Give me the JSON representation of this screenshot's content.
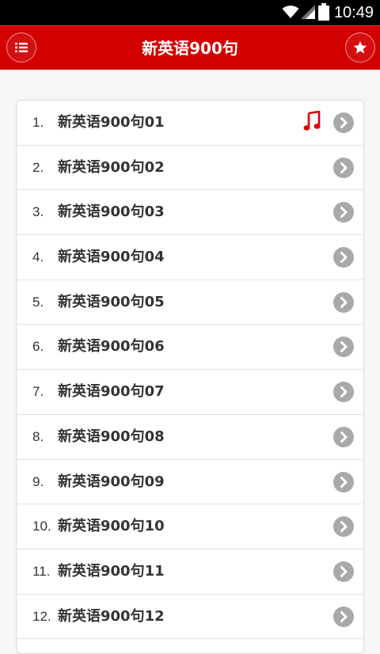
{
  "status_bar": {
    "time": "10:49",
    "icons": [
      "wifi-icon",
      "signal-icon",
      "battery-icon"
    ]
  },
  "app_bar": {
    "title": "新英语900句",
    "left_button_icon": "list-menu-icon",
    "right_button_icon": "star-icon",
    "color": "#d30000"
  },
  "list": {
    "items": [
      {
        "num": "1.",
        "label": "新英语900句01",
        "playing": true
      },
      {
        "num": "2.",
        "label": "新英语900句02"
      },
      {
        "num": "3.",
        "label": "新英语900句03"
      },
      {
        "num": "4.",
        "label": "新英语900句04"
      },
      {
        "num": "5.",
        "label": "新英语900句05"
      },
      {
        "num": "6.",
        "label": "新英语900句06"
      },
      {
        "num": "7.",
        "label": "新英语900句07"
      },
      {
        "num": "8.",
        "label": "新英语900句08"
      },
      {
        "num": "9.",
        "label": "新英语900句09"
      },
      {
        "num": "10.",
        "label": "新英语900句10"
      },
      {
        "num": "11.",
        "label": "新英语900句11"
      },
      {
        "num": "12.",
        "label": "新英语900句12"
      }
    ],
    "row_icon": "chevron-right-circle-icon",
    "playing_icon": "music-note-icon",
    "accent": "#e00000"
  }
}
